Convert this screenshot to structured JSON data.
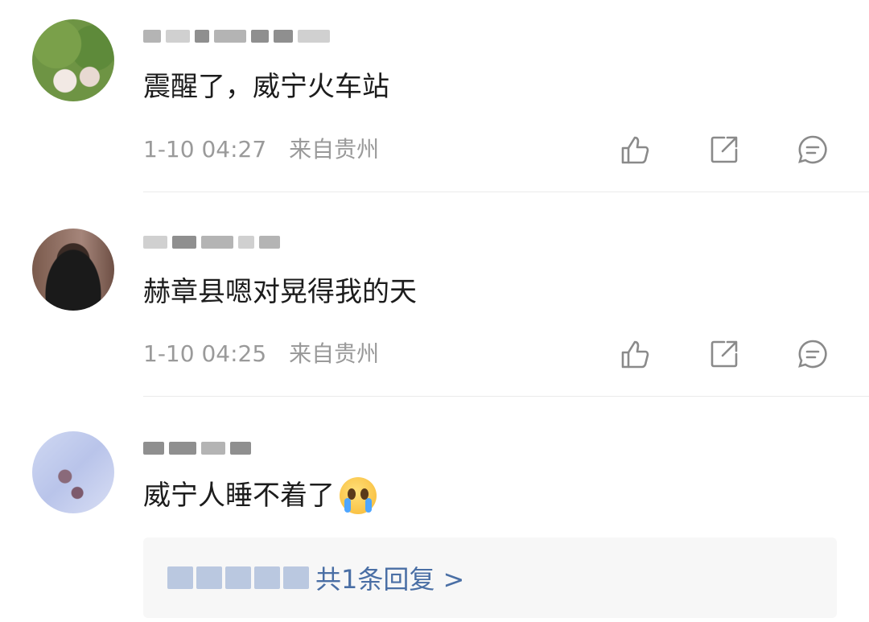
{
  "comments": [
    {
      "text": "震醒了，威宁火车站",
      "time": "1-10 04:27",
      "location": "来自贵州"
    },
    {
      "text": "赫章县嗯对晃得我的天",
      "time": "1-10 04:25",
      "location": "来自贵州"
    },
    {
      "text": "威宁人睡不着了",
      "emoji": "crying-face-emoji"
    }
  ],
  "reply": {
    "label": "共1条回复 >"
  },
  "icons": {
    "like": "thumbs-up-icon",
    "share": "share-icon",
    "comment": "comment-icon"
  },
  "colors": {
    "text": "#1c1c1c",
    "meta": "#9a9a9a",
    "link": "#4a6fa5",
    "divider": "#ebebeb"
  }
}
